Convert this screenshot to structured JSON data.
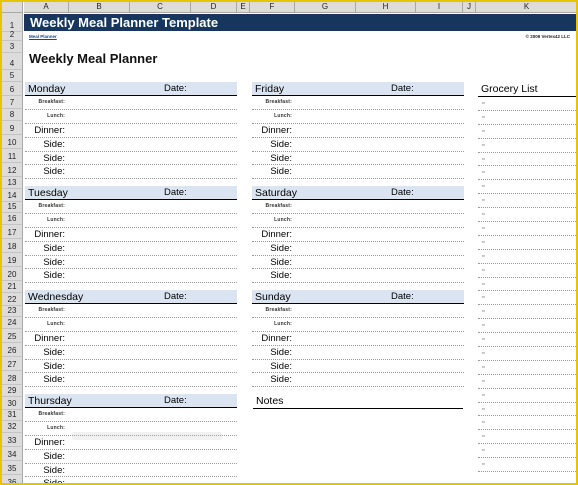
{
  "columns": [
    "A",
    "B",
    "C",
    "D",
    "E",
    "F",
    "G",
    "H",
    "I",
    "J",
    "K"
  ],
  "rows": [
    "1",
    "2",
    "3",
    "4",
    "5",
    "6",
    "7",
    "8",
    "9",
    "10",
    "11",
    "12",
    "13",
    "14",
    "15",
    "16",
    "17",
    "18",
    "19",
    "20",
    "21",
    "22",
    "23",
    "24",
    "25",
    "26",
    "27",
    "28",
    "29",
    "30",
    "31",
    "32",
    "33",
    "34",
    "35",
    "36"
  ],
  "title": "Weekly Meal Planner Template",
  "meta": {
    "link": "Meal Planner",
    "copyright": "© 2009 Vertex42 LLC"
  },
  "heading": "Weekly Meal Planner",
  "labels": {
    "date": "Date:",
    "breakfast": "Breakfast:",
    "lunch": "Lunch:",
    "dinner": "Dinner:",
    "side": "Side:"
  },
  "days": {
    "monday": "Monday",
    "tuesday": "Tuesday",
    "wednesday": "Wednesday",
    "thursday": "Thursday",
    "friday": "Friday",
    "saturday": "Saturday",
    "sunday": "Sunday"
  },
  "notes_label": "Notes",
  "grocery": {
    "title": "Grocery List",
    "bullet": "▫"
  }
}
